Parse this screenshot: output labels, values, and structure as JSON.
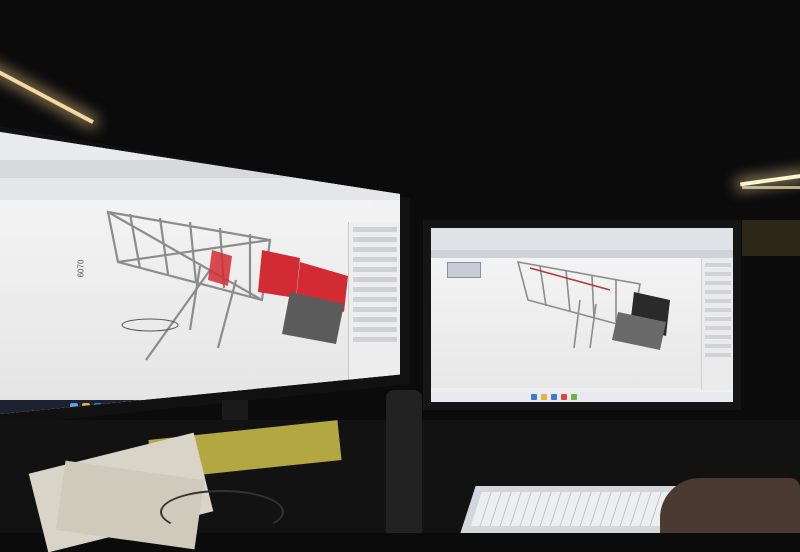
{
  "left_monitor": {
    "command_line_1": "",
    "command_line_2": "",
    "dimension_label": "6070"
  },
  "colors": {
    "frame": "#8c8c8c",
    "red_panel": "#d22b33",
    "dark_panel": "#2a2a2a",
    "viewport_bg": "#f2f2f2",
    "taskbar": "#1d2230"
  },
  "icons": [
    "tool-icon",
    "windows-start-icon",
    "taskbar-app-icon"
  ]
}
